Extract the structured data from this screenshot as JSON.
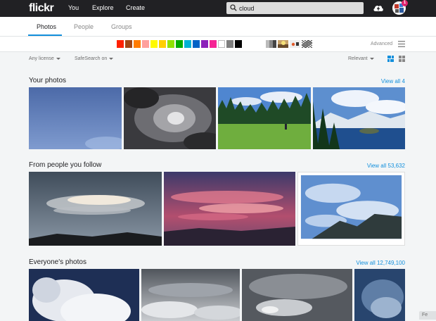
{
  "header": {
    "logo": "flickr",
    "nav": [
      "You",
      "Explore",
      "Create"
    ],
    "search_value": "cloud",
    "notification_count": "1"
  },
  "tabs": {
    "items": [
      "Photos",
      "People",
      "Groups"
    ],
    "active": "Photos"
  },
  "filters": {
    "colors": [
      "#ff2000",
      "#a24615",
      "#ff7c00",
      "#ff9f9c",
      "#fffa00",
      "#ffcf00",
      "#90e200",
      "#00ab00",
      "#00b2d4",
      "#0062c6",
      "#8c20ba",
      "#f52394",
      "#ffffff",
      "#7e7e7e",
      "#000000"
    ],
    "advanced_label": "Advanced",
    "license_label": "Any license",
    "safesearch_label": "SafeSearch on",
    "sort_label": "Relevant"
  },
  "sections": {
    "your_photos": {
      "title": "Your photos",
      "view_all": "View all 4"
    },
    "following": {
      "title": "From people you follow",
      "view_all": "View all 53,632"
    },
    "everyone": {
      "title": "Everyone's photos",
      "view_all": "View all 12,749,100"
    }
  },
  "feedback_label": "Fe",
  "colors": {
    "accent": "#128fdc",
    "topbar": "#212124",
    "background": "#f3f5f6"
  }
}
